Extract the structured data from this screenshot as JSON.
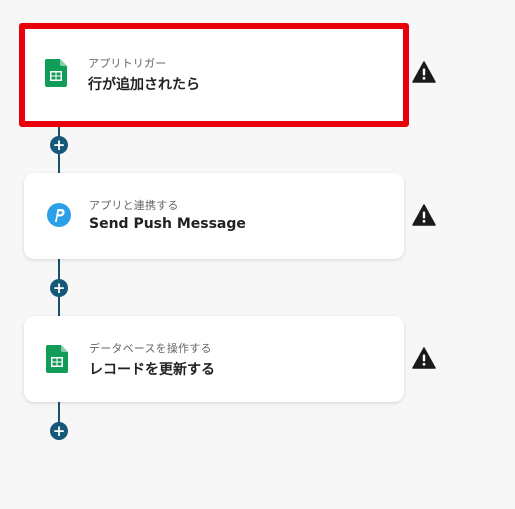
{
  "flow": {
    "steps": [
      {
        "subtitle": "アプリトリガー",
        "title": "行が追加されたら",
        "icon": "google-sheets-icon",
        "selected": true,
        "status": "warning-icon"
      },
      {
        "subtitle": "アプリと連携する",
        "title": "Send Push Message",
        "icon": "pushbullet-icon",
        "selected": false,
        "status": "warning-icon"
      },
      {
        "subtitle": "データベースを操作する",
        "title": "レコードを更新する",
        "icon": "google-sheets-icon",
        "selected": false,
        "status": "warning-icon"
      }
    ],
    "add_button_label": "+"
  },
  "colors": {
    "background": "#f7f7f7",
    "selection_border": "#e8000b",
    "connector": "#19506a",
    "add_button": "#15587a",
    "sheets_green": "#0f9d58",
    "pushbullet_blue": "#2ba0e8"
  }
}
